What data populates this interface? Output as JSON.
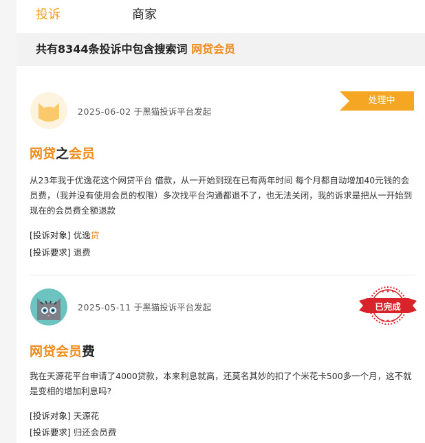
{
  "tabs": [
    {
      "label": "投诉",
      "active": true
    },
    {
      "label": "商家",
      "active": false
    }
  ],
  "banner": {
    "prefix": "共有8344条投诉中包含搜索词",
    "keyword": "网贷会员"
  },
  "complaints": [
    {
      "date": "2025-06-02",
      "source": "于黑猫投诉平台发起",
      "status": "处理中",
      "title_hl1": "网贷",
      "title_plain": "之",
      "title_hl2": "会员",
      "body": "从23年我于优逸花这个网贷平台 借款，从一开始到现在已有两年时间 每个月都自动增加40元钱的会员费，（我并没有使用会员的权限）多次找平台沟通都退不了，也无法关闭，我的诉求是把从一开始到现在的会员费全额退款",
      "target_label": "[投诉对象]",
      "target_plain": "优逸",
      "target_hl": "贷",
      "request_label": "[投诉要求]",
      "request": "退费"
    },
    {
      "date": "2025-05-11",
      "source": "于黑猫投诉平台发起",
      "status": "已完成",
      "title_hl": "网贷会员",
      "title_plain": "费",
      "body": "我在天源花平台申请了4000贷款，本来利息就高，还莫名其妙的扣了个米花卡500多一个月，这不就是变相的增加利息吗?",
      "target_label": "[投诉对象]",
      "target": "天源花",
      "request_label": "[投诉要求]",
      "request": "归还会员费"
    }
  ],
  "colors": {
    "accent": "#f2a01a",
    "keyword": "#f08a18",
    "done_red": "#d8232a"
  },
  "icons": {
    "avatar1": "yellow-cat-avatar",
    "avatar2": "grey-cat-avatar",
    "status_done": "completed-seal-icon"
  }
}
